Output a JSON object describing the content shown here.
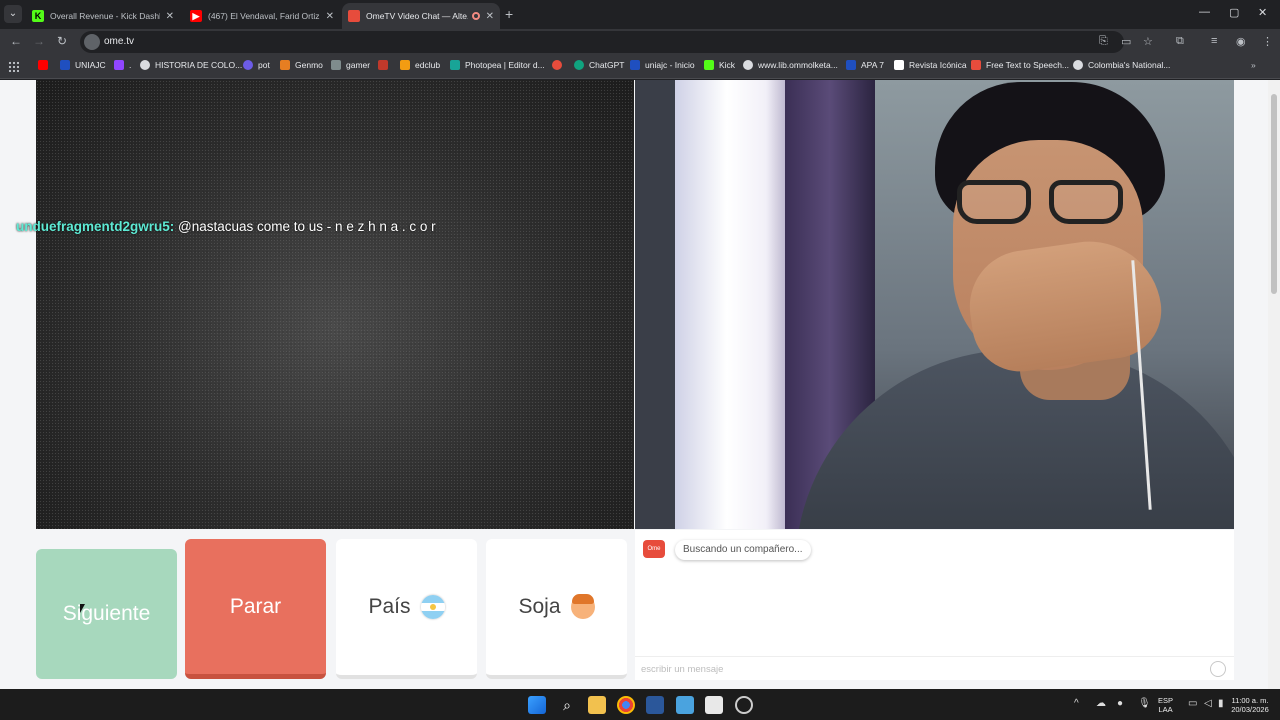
{
  "tabs": [
    {
      "title": "Overall Revenue - Kick Dashbo...",
      "color": "#53fc18"
    },
    {
      "title": "(467) El Vendaval, Farid Ortiz - ...",
      "color": "#ff0000"
    },
    {
      "title": "OmeTV Video Chat — Alte...",
      "color": "#e74c3c"
    }
  ],
  "address_bar": {
    "url": "ome.tv"
  },
  "bookmarks": [
    {
      "label": "",
      "color": "#ff0000"
    },
    {
      "label": "UNIAJC",
      "color": "#1f4fbf"
    },
    {
      "label": ".",
      "color": "#9146ff"
    },
    {
      "label": "HISTORIA DE COLO...",
      "color": "#dadce0"
    },
    {
      "label": "pot",
      "color": "#6c5ce7"
    },
    {
      "label": "Genmo",
      "color": "#e67e22"
    },
    {
      "label": "gamer",
      "color": "#7f8c8d"
    },
    {
      "label": "edclub",
      "color": "#f39c12"
    },
    {
      "label": "Photopea | Editor d...",
      "color": "#18a497"
    },
    {
      "label": "ChatGPT",
      "color": "#10a37f"
    },
    {
      "label": "uniajc - Inicio",
      "color": "#1f4fbf"
    },
    {
      "label": "Kick",
      "color": "#53fc18"
    },
    {
      "label": "www.lib.ommolketa...",
      "color": "#dadce0"
    },
    {
      "label": "APA 7",
      "color": "#1f4fbf"
    },
    {
      "label": "Revista Icónica",
      "color": "#ffffff"
    },
    {
      "label": "Free Text to Speech...",
      "color": "#e74c3c"
    },
    {
      "label": "Colombia's National...",
      "color": "#dadce0"
    }
  ],
  "stream_chat": {
    "username": "unduefragmentd2gwru5:",
    "message": "@nastacuas come to us - n e z h n a . c o r"
  },
  "controls": {
    "next": "Siguiente",
    "stop": "Parar",
    "country": "País",
    "gender": "Soja"
  },
  "chat": {
    "logo": "Ome TV",
    "status": "Buscando un compañero...",
    "placeholder": "escribir un mensaje"
  },
  "taskbar": {
    "lang_line1": "ESP",
    "lang_line2": "LAA",
    "time": "11:00 a. m.",
    "date": "20/03/2026"
  },
  "colors": {
    "next_button": "#a7d8bd",
    "stop_button": "#e8705e",
    "username": "#5eead4"
  }
}
